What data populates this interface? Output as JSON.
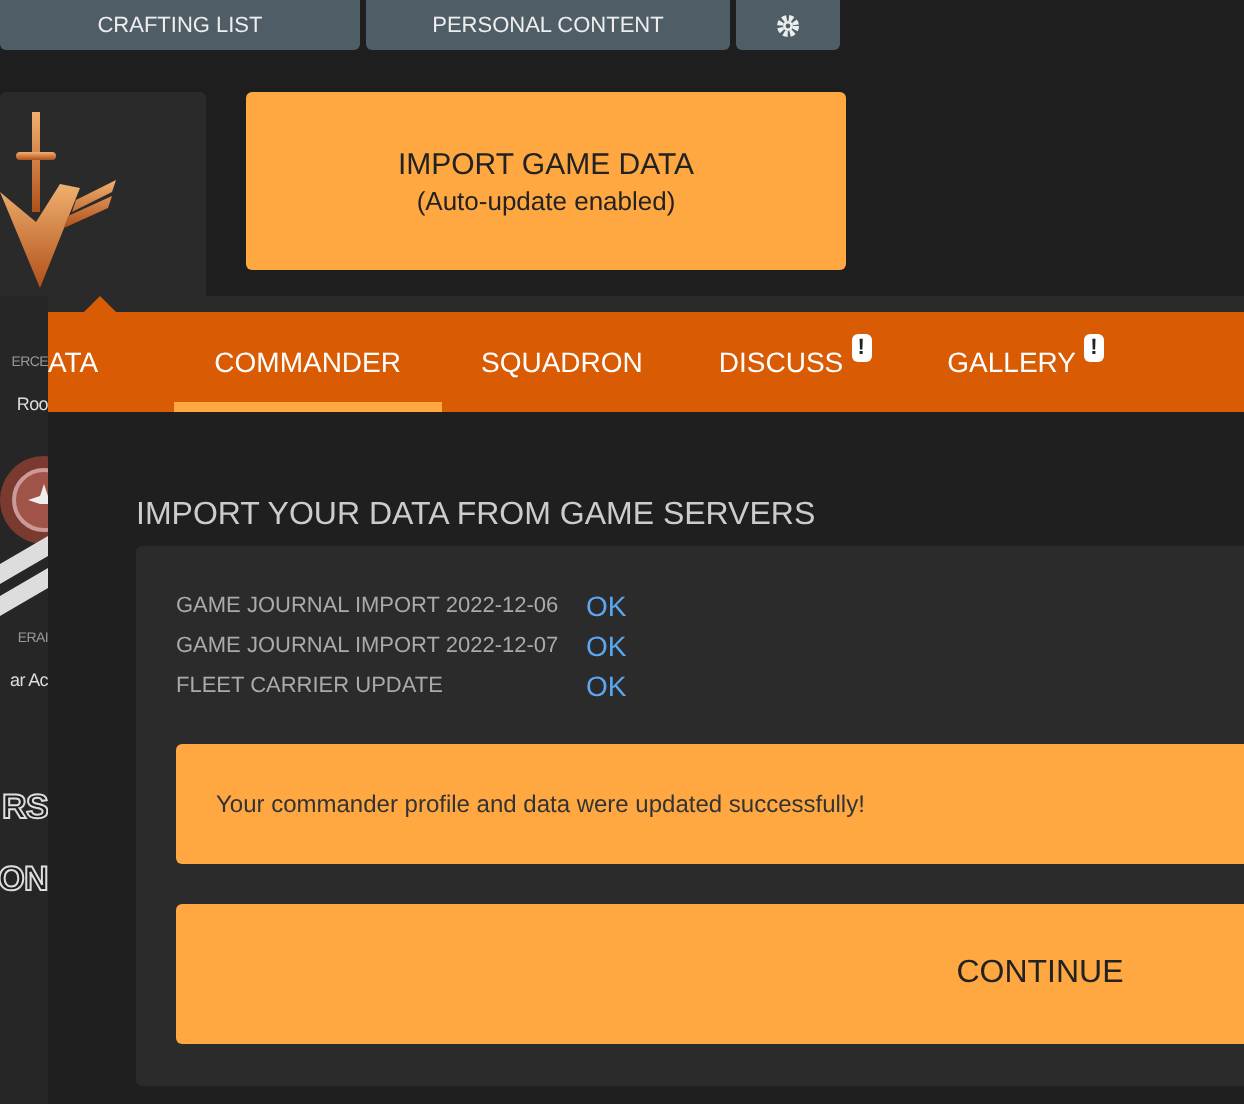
{
  "top_nav": [
    {
      "kind": "text",
      "label": "CRAFTING LIST"
    },
    {
      "kind": "text",
      "label": "PERSONAL CONTENT"
    },
    {
      "kind": "icon"
    }
  ],
  "import_button": {
    "title": "IMPORT GAME DATA",
    "subtitle": "(Auto-update enabled)"
  },
  "side_texts": [
    {
      "kind": "small",
      "text": "ERCE"
    },
    {
      "kind": "name",
      "text": "Roo"
    },
    {
      "kind": "emblem"
    },
    {
      "kind": "small",
      "text": "ERAI"
    },
    {
      "kind": "name",
      "text": "ar Ac"
    },
    {
      "kind": "big",
      "text": "RS"
    },
    {
      "kind": "big",
      "text": "ON"
    }
  ],
  "dialog": {
    "tabs": [
      {
        "label": "ATA",
        "selected": false,
        "alert": false
      },
      {
        "label": "COMMANDER",
        "selected": true,
        "alert": false
      },
      {
        "label": "SQUADRON",
        "selected": false,
        "alert": false
      },
      {
        "label": "DISCUSS",
        "selected": false,
        "alert": true,
        "badge": "!"
      },
      {
        "label": "GALLERY",
        "selected": false,
        "alert": true,
        "badge": "!"
      }
    ],
    "title": "IMPORT YOUR DATA FROM GAME SERVERS",
    "results": [
      {
        "label": "GAME JOURNAL IMPORT 2022-12-06",
        "status": "OK"
      },
      {
        "label": "GAME JOURNAL IMPORT 2022-12-07",
        "status": "OK"
      },
      {
        "label": "FLEET CARRIER UPDATE",
        "status": "OK"
      }
    ],
    "message": "Your commander profile and data were updated successfully!",
    "continue_button": "CONTINUE"
  }
}
